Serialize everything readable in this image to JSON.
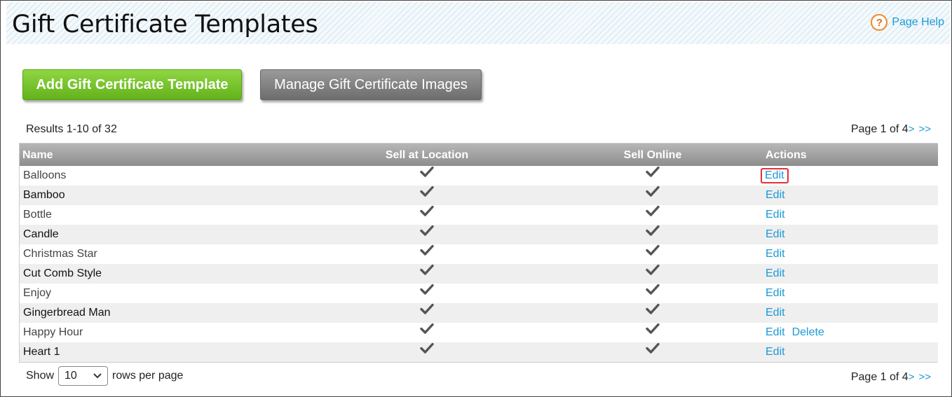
{
  "header": {
    "title": "Gift Certificate Templates",
    "help_label": "Page Help",
    "help_glyph": "?"
  },
  "toolbar": {
    "add_label": "Add Gift Certificate Template",
    "manage_label": "Manage Gift Certificate Images"
  },
  "results_text": "Results 1-10 of 32",
  "pagination": {
    "text": "Page 1 of 4",
    "next": ">",
    "last": ">>"
  },
  "table": {
    "columns": {
      "name": "Name",
      "sell_location": "Sell at Location",
      "sell_online": "Sell Online",
      "actions": "Actions"
    },
    "rows": [
      {
        "name": "Balloons",
        "edit": "Edit"
      },
      {
        "name": "Bamboo",
        "edit": "Edit"
      },
      {
        "name": "Bottle",
        "edit": "Edit"
      },
      {
        "name": "Candle",
        "edit": "Edit"
      },
      {
        "name": "Christmas Star",
        "edit": "Edit"
      },
      {
        "name": "Cut Comb Style",
        "edit": "Edit"
      },
      {
        "name": "Enjoy",
        "edit": "Edit"
      },
      {
        "name": "Gingerbread Man",
        "edit": "Edit"
      },
      {
        "name": "Happy Hour",
        "edit": "Edit",
        "delete": "Delete"
      },
      {
        "name": "Heart 1",
        "edit": "Edit"
      }
    ]
  },
  "footer": {
    "show_label": "Show",
    "rows_per_page": "10",
    "rows_label": "rows per page"
  },
  "colors": {
    "accent_link": "#1a9ad6",
    "add_button": "#6cbf23",
    "manage_button": "#7d7d7d",
    "highlight": "#e0303a"
  },
  "icons": {
    "help": "help-icon",
    "check": "checkmark-icon",
    "dropdown": "chevron-down-icon"
  }
}
